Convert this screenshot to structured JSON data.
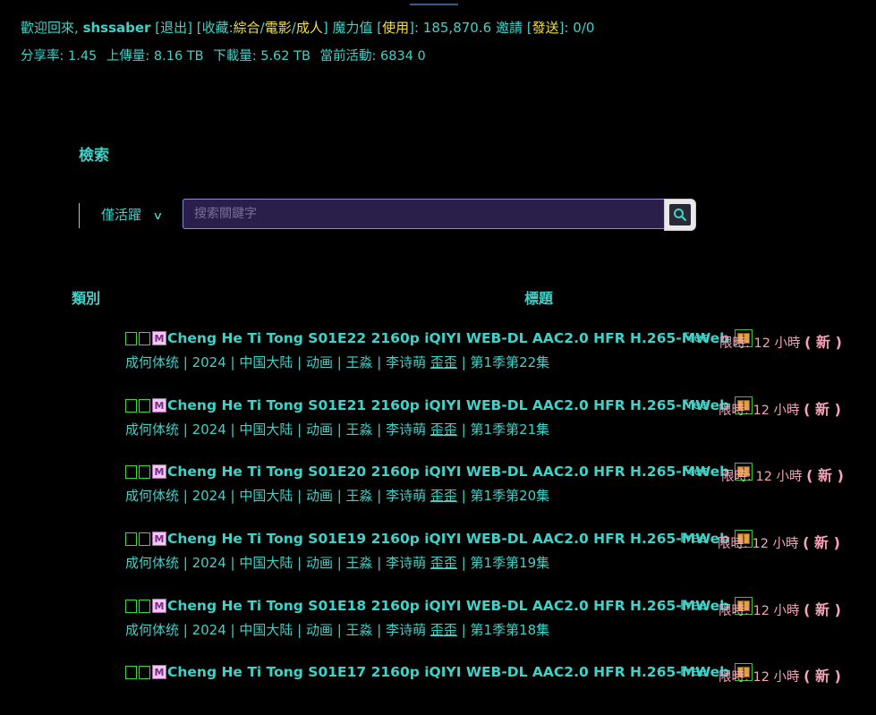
{
  "user_bar": {
    "welcome": "歡迎回來,",
    "username": "shssaber",
    "logout": "[退出]",
    "favorites_label": "[收藏:",
    "fav_all": "綜合",
    "fav_movie": "電影",
    "fav_adult": "成人",
    "favorites_close": "]",
    "magic_label": "魔力值",
    "magic_use": "使用",
    "magic_value": ": 185,870.6",
    "invite_label": "邀請",
    "invite_send": "發送",
    "invite_value": ": 0/0",
    "ratio_label": "分享率:",
    "ratio_value": "1.45",
    "upload_label": "上傳量:",
    "upload_value": "8.16 TB",
    "download_label": "下載量:",
    "download_value": "5.62 TB",
    "active_label": "當前活動:",
    "active_seeding": "6834",
    "active_leeching": "0"
  },
  "search": {
    "title": "檢索",
    "filter_label": "僅活躍",
    "placeholder": "搜索關鍵字"
  },
  "table": {
    "col_category": "類別",
    "col_title": "標題"
  },
  "torrents": [
    {
      "title": "Cheng He Ti Tong S01E22 2160p iQIYI WEB-DL AAC2.0 HFR H.265-MWeb",
      "free": "Free",
      "limit": "限時: 12 小時",
      "new": "( 新 )",
      "sub_a": "成何体统 | 2024 | 中国大陆 | 动画 | 王淼 | 李诗萌",
      "sub_b": "歪歪",
      "sub_c": "| 第1季第22集"
    },
    {
      "title": "Cheng He Ti Tong S01E21 2160p iQIYI WEB-DL AAC2.0 HFR H.265-MWeb",
      "free": "Free",
      "limit": "限時: 12 小時",
      "new": "( 新 )",
      "sub_a": "成何体统 | 2024 | 中国大陆 | 动画 | 王淼 | 李诗萌",
      "sub_b": "歪歪",
      "sub_c": "| 第1季第21集"
    },
    {
      "title": "Cheng He Ti Tong S01E20 2160p iQIYI WEB-DL AAC2.0 HFR H.265-MWeb",
      "free": "Free",
      "limit": "限時: 12 小時",
      "new": "( 新 )",
      "sub_a": "成何体统 | 2024 | 中国大陆 | 动画 | 王淼 | 李诗萌",
      "sub_b": "歪歪",
      "sub_c": "| 第1季第20集"
    },
    {
      "title": "Cheng He Ti Tong S01E19 2160p iQIYI WEB-DL AAC2.0 HFR H.265-MWeb",
      "free": "Free",
      "limit": "限時: 12 小時",
      "new": "( 新 )",
      "sub_a": "成何体统 | 2024 | 中国大陆 | 动画 | 王淼 | 李诗萌",
      "sub_b": "歪歪",
      "sub_c": "| 第1季第19集"
    },
    {
      "title": "Cheng He Ti Tong S01E18 2160p iQIYI WEB-DL AAC2.0 HFR H.265-MWeb",
      "free": "Free",
      "limit": "限時: 12 小時",
      "new": "( 新 )",
      "sub_a": "成何体统 | 2024 | 中国大陆 | 动画 | 王淼 | 李诗萌",
      "sub_b": "歪歪",
      "sub_c": "| 第1季第18集"
    },
    {
      "title": "Cheng He Ti Tong S01E17 2160p iQIYI WEB-DL AAC2.0 HFR H.265-MWeb",
      "free": "Free",
      "limit": "限時: 12 小時",
      "new": "( 新 )",
      "sub_a": "",
      "sub_b": "",
      "sub_c": ""
    }
  ],
  "badges": {
    "m_label": "M"
  },
  "colors": {
    "background": "#000000",
    "text": "#3fd2c8",
    "link_yellow": "#f0e040",
    "limit_pink": "#f4a3b8",
    "search_bg": "#2a1e4a"
  }
}
